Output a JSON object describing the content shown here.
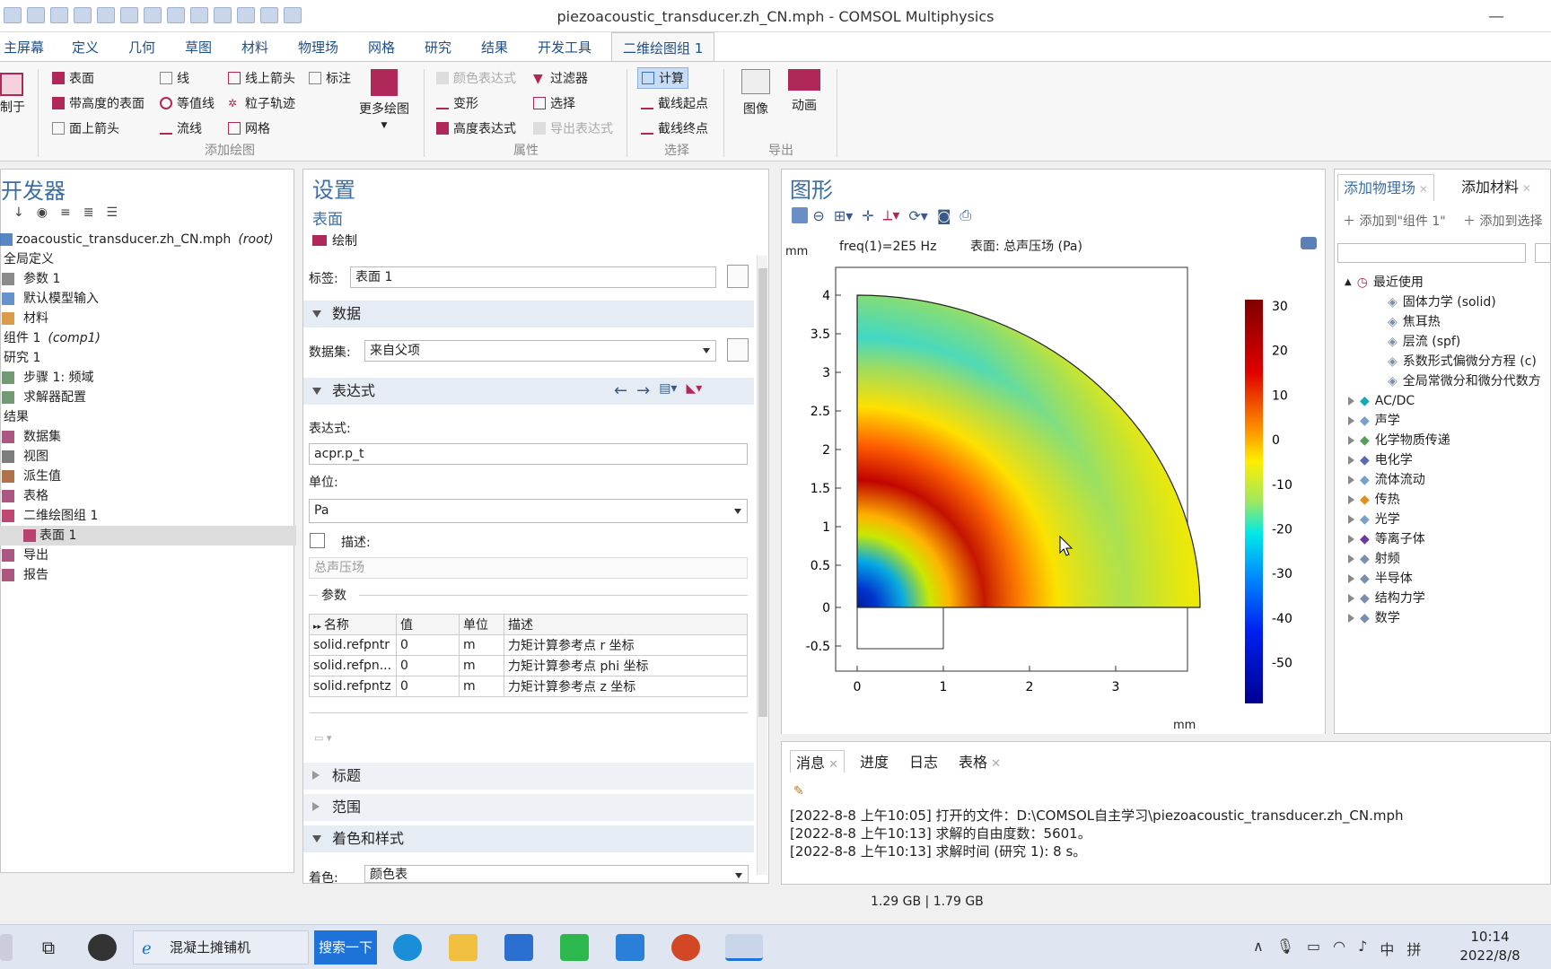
{
  "window": {
    "title": "piezoacoustic_transducer.zh_CN.mph - COMSOL Multiphysics",
    "minimize": "—"
  },
  "tabs": [
    "主屏幕",
    "定义",
    "几何",
    "草图",
    "材料",
    "物理场",
    "网格",
    "研究",
    "结果",
    "开发工具",
    "二维绘图组 1"
  ],
  "ribbon": {
    "plot_in": "制于",
    "add_plot": {
      "surface": "表面",
      "height_surface": "带高度的表面",
      "surface_arrow": "面上箭头",
      "line": "线",
      "contour": "等值线",
      "streamline": "流线",
      "line_arrow": "线上箭头",
      "particle": "粒子轨迹",
      "mesh": "网格",
      "annotation": "标注",
      "more": "更多绘图",
      "group": "添加绘图"
    },
    "attributes": {
      "color_expr": "颜色表达式",
      "deform": "变形",
      "height_expr": "高度表达式",
      "filter": "过滤器",
      "selection": "选择",
      "export_expr": "导出表达式",
      "group": "属性"
    },
    "select": {
      "compute": "计算",
      "cut_start": "截线起点",
      "cut_end": "截线终点",
      "group": "选择"
    },
    "export": {
      "image": "图像",
      "animation": "动画",
      "group": "导出"
    }
  },
  "model_builder": {
    "title": "开发器",
    "items": [
      {
        "label": "zoacoustic_transducer.zh_CN.mph",
        "suffix": "(root)",
        "indent": 0,
        "color": "#3b73b9"
      },
      {
        "label": "全局定义",
        "suffix": "",
        "indent": 0,
        "color": "#888"
      },
      {
        "label": "参数 1",
        "suffix": "",
        "indent": 1,
        "color": "#777"
      },
      {
        "label": "默认模型输入",
        "suffix": "",
        "indent": 1,
        "color": "#4a7fc1"
      },
      {
        "label": "材料",
        "suffix": "",
        "indent": 1,
        "color": "#d18b2c"
      },
      {
        "label": "组件 1",
        "suffix": "(comp1)",
        "indent": 0,
        "color": "#888"
      },
      {
        "label": "研究 1",
        "suffix": "",
        "indent": 0,
        "color": "#888"
      },
      {
        "label": "步骤 1: 频域",
        "suffix": "",
        "indent": 1,
        "color": "#5a8a5a"
      },
      {
        "label": "求解器配置",
        "suffix": "",
        "indent": 1,
        "color": "#5a8a5a"
      },
      {
        "label": "结果",
        "suffix": "",
        "indent": 0,
        "color": "#888"
      },
      {
        "label": "数据集",
        "suffix": "",
        "indent": 1,
        "color": "#9c3a6a"
      },
      {
        "label": "视图",
        "suffix": "",
        "indent": 1,
        "color": "#666"
      },
      {
        "label": "派生值",
        "suffix": "",
        "indent": 1,
        "color": "#a05a2c"
      },
      {
        "label": "表格",
        "suffix": "",
        "indent": 1,
        "color": "#9c3a6a"
      },
      {
        "label": "二维绘图组 1",
        "suffix": "",
        "indent": 1,
        "color": "#b0285a"
      },
      {
        "label": "表面 1",
        "suffix": "",
        "indent": 2,
        "color": "#b0285a",
        "selected": true
      },
      {
        "label": "导出",
        "suffix": "",
        "indent": 1,
        "color": "#9c3a6a"
      },
      {
        "label": "报告",
        "suffix": "",
        "indent": 1,
        "color": "#9c3a6a"
      }
    ]
  },
  "settings": {
    "title": "设置",
    "subtitle": "表面",
    "plot_btn": "绘制",
    "label_label": "标签:",
    "label_value": "表面 1",
    "sec_data": "数据",
    "dataset_label": "数据集:",
    "dataset_value": "来自父项",
    "sec_expr": "表达式",
    "expr_label": "表达式:",
    "expr_value": "acpr.p_t",
    "unit_label": "单位:",
    "unit_value": "Pa",
    "desc_label": "描述:",
    "desc_value": "总声压场",
    "params_label": "参数",
    "params_headers": [
      "名称",
      "值",
      "单位",
      "描述"
    ],
    "params_rows": [
      [
        "solid.refpntr",
        "0",
        "m",
        "力矩计算参考点 r 坐标"
      ],
      [
        "solid.refpn...",
        "0",
        "m",
        "力矩计算参考点 phi 坐标"
      ],
      [
        "solid.refpntz",
        "0",
        "m",
        "力矩计算参考点 z 坐标"
      ]
    ],
    "sec_title": "标题",
    "sec_range": "范围",
    "sec_color": "着色和样式",
    "color_label": "着色:",
    "color_value": "颜色表"
  },
  "graphics": {
    "title": "图形",
    "freq_label": "freq(1)=2E5 Hz",
    "plot_title": "表面: 总声压场 (Pa)",
    "unit_y": "mm",
    "unit_x": "mm",
    "xticks": [
      "0",
      "1",
      "2",
      "3"
    ],
    "yticks": [
      "4",
      "3.5",
      "3",
      "2.5",
      "2",
      "1.5",
      "1",
      "0.5",
      "0",
      "-0.5"
    ],
    "colorbar": [
      "30",
      "20",
      "10",
      "0",
      "-10",
      "-20",
      "-30",
      "-40",
      "-50"
    ]
  },
  "messages": {
    "tabs": [
      "消息",
      "进度",
      "日志",
      "表格"
    ],
    "lines": [
      "[2022-8-8 上午10:05] 打开的文件：D:\\COMSOL自主学习\\piezoacoustic_transducer.zh_CN.mph",
      "[2022-8-8 上午10:13] 求解的自由度数：5601。",
      "[2022-8-8 上午10:13] 求解时间 (研究 1): 8 s。"
    ]
  },
  "physics": {
    "tabs": [
      "添加物理场",
      "添加材料"
    ],
    "add_to": "添加到\"组件 1\"",
    "add_to_sel": "添加到选择",
    "recent": "最近使用",
    "recent_items": [
      "固体力学 (solid)",
      "焦耳热",
      "层流 (spf)",
      "系数形式偏微分方程 (c)",
      "全局常微分和微分代数方"
    ],
    "categories": [
      "AC/DC",
      "声学",
      "化学物质传递",
      "电化学",
      "流体流动",
      "传热",
      "光学",
      "等离子体",
      "射频",
      "半导体",
      "结构力学",
      "数学"
    ]
  },
  "status": {
    "memory": "1.29 GB | 1.79 GB"
  },
  "taskbar": {
    "search_text": "混凝土摊铺机",
    "search_btn": "搜索一下",
    "time": "10:14",
    "date": "2022/8/8",
    "ime1": "中",
    "ime2": "拼"
  }
}
